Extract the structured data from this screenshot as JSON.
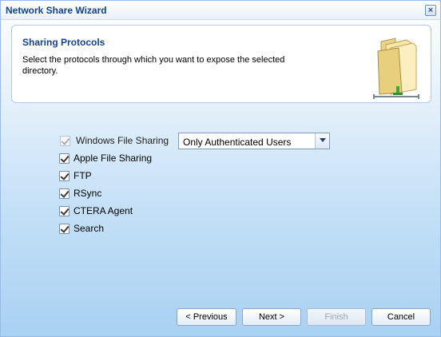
{
  "window": {
    "title": "Network Share Wizard",
    "close_glyph": "×"
  },
  "header": {
    "title": "Sharing Protocols",
    "description": "Select the protocols through which you want to expose the selected directory.",
    "icon": "folder-share-icon"
  },
  "protocols": [
    {
      "label": "Windows File Sharing",
      "checked": true,
      "disabled": true
    },
    {
      "label": "Apple File Sharing",
      "checked": true,
      "disabled": false
    },
    {
      "label": "FTP",
      "checked": true,
      "disabled": false
    },
    {
      "label": "RSync",
      "checked": true,
      "disabled": false
    },
    {
      "label": "CTERA Agent",
      "checked": true,
      "disabled": false
    },
    {
      "label": "Search",
      "checked": true,
      "disabled": false
    }
  ],
  "access_select": {
    "value": "Only Authenticated Users"
  },
  "buttons": {
    "previous": "< Previous",
    "next": "Next >",
    "finish": "Finish",
    "cancel": "Cancel"
  },
  "colors": {
    "title": "#15428b",
    "border": "#99bbe8"
  }
}
